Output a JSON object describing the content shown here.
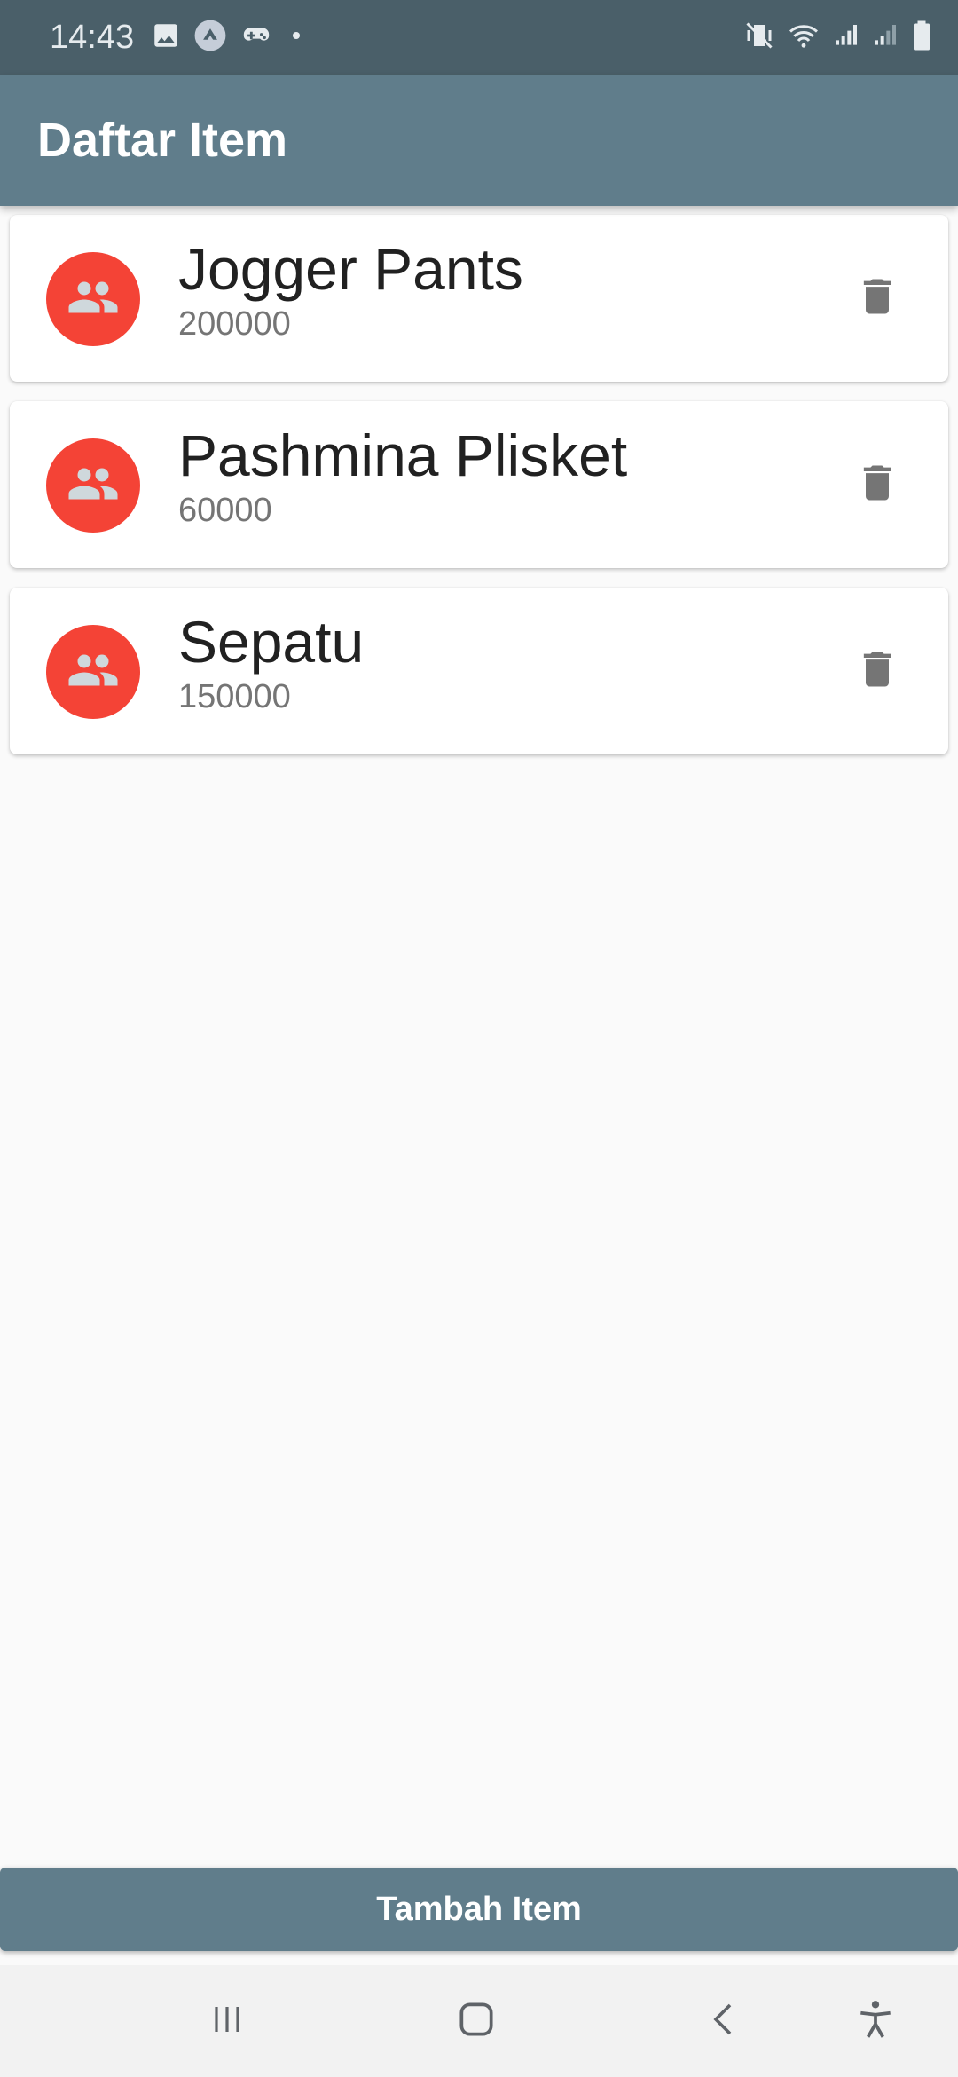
{
  "status_bar": {
    "time": "14:43",
    "left_icons": [
      "image-icon",
      "sync-icon",
      "game-controller-icon",
      "notification-dot-icon"
    ],
    "right_icons": [
      "mute-vibrate-icon",
      "wifi-icon",
      "cell-signal-icon",
      "cell-signal-2-icon",
      "battery-icon"
    ]
  },
  "app_bar": {
    "title": "Daftar Item"
  },
  "items": [
    {
      "name": "Jogger Pants",
      "price": "200000"
    },
    {
      "name": "Pashmina Plisket",
      "price": "60000"
    },
    {
      "name": "Sepatu",
      "price": "150000"
    }
  ],
  "add_button": {
    "label": "Tambah Item"
  },
  "nav_bar": {
    "buttons": [
      "recent-apps-icon",
      "home-icon",
      "back-icon",
      "accessibility-icon"
    ]
  },
  "colors": {
    "status_bar": "#4a5f69",
    "app_bar": "#607d8b",
    "avatar": "#f44336",
    "delete_icon": "#757575",
    "background": "#fafafa"
  }
}
